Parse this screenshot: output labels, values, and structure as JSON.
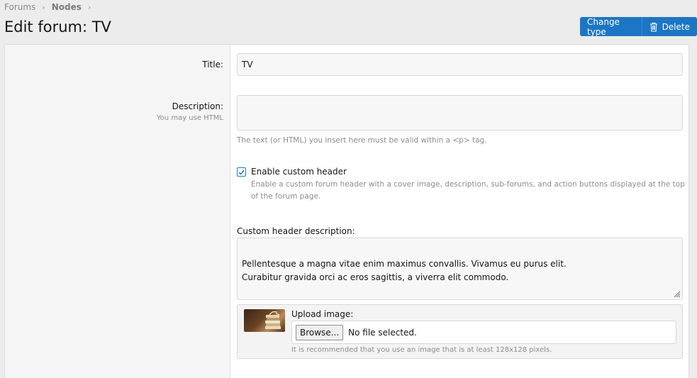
{
  "breadcrumb": {
    "items": [
      "Forums",
      "Nodes"
    ],
    "separator": "›"
  },
  "page": {
    "title": "Edit forum: TV"
  },
  "actions": {
    "change_type": "Change type",
    "delete": "Delete",
    "accent": "#1d76c3"
  },
  "form": {
    "title": {
      "label": "Title:",
      "value": "TV"
    },
    "description": {
      "label": "Description:",
      "hint": "You may use HTML",
      "value": "",
      "explain": "The text (or HTML) you insert here must be valid within a <p> tag."
    },
    "custom_header": {
      "checked": true,
      "label": "Enable custom header",
      "hint": "Enable a custom forum header with a cover image, description, sub-forums, and action buttons displayed at the top of the forum page."
    },
    "custom_description": {
      "label": "Custom header description:",
      "value": "Pellentesque a magna vitae enim maximus convallis. Vivamus eu purus elit.\nCurabitur gravida orci ac eros sagittis, a viverra elit commodo."
    },
    "upload": {
      "label": "Upload image:",
      "browse": "Browse...",
      "status": "No file selected.",
      "hint": "It is recommended that you use an image that is at least 128x128 pixels."
    }
  }
}
